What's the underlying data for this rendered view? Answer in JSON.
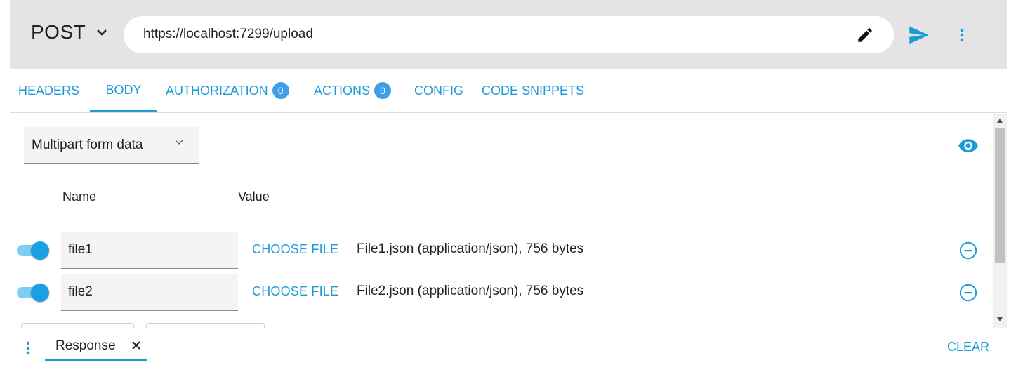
{
  "request": {
    "method": "POST",
    "url": "https://localhost:7299/upload"
  },
  "tabs": [
    {
      "label": "HEADERS",
      "active": false
    },
    {
      "label": "BODY",
      "active": true
    },
    {
      "label": "AUTHORIZATION",
      "badge": "0",
      "active": false
    },
    {
      "label": "ACTIONS",
      "badge": "0",
      "active": false
    },
    {
      "label": "CONFIG",
      "active": false
    },
    {
      "label": "CODE SNIPPETS",
      "active": false
    }
  ],
  "body": {
    "type_selected": "Multipart form data",
    "columns": {
      "name": "Name",
      "value": "Value"
    },
    "rows": [
      {
        "enabled": true,
        "name": "file1",
        "choose_label": "CHOOSE FILE",
        "file_info": "File1.json (application/json), 756 bytes"
      },
      {
        "enabled": true,
        "name": "file2",
        "choose_label": "CHOOSE FILE",
        "file_info": "File2.json (application/json), 756 bytes"
      }
    ]
  },
  "response_panel": {
    "tab_label": "Response",
    "clear_label": "CLEAR"
  },
  "colors": {
    "accent": "#1e9bd7",
    "badge": "#3e9ee6",
    "bar_background": "#e4e4e4"
  },
  "icons": [
    "chevron-down-icon",
    "edit-icon",
    "send-icon",
    "more-vert-icon",
    "eye-icon",
    "remove-circle-icon",
    "close-icon"
  ]
}
